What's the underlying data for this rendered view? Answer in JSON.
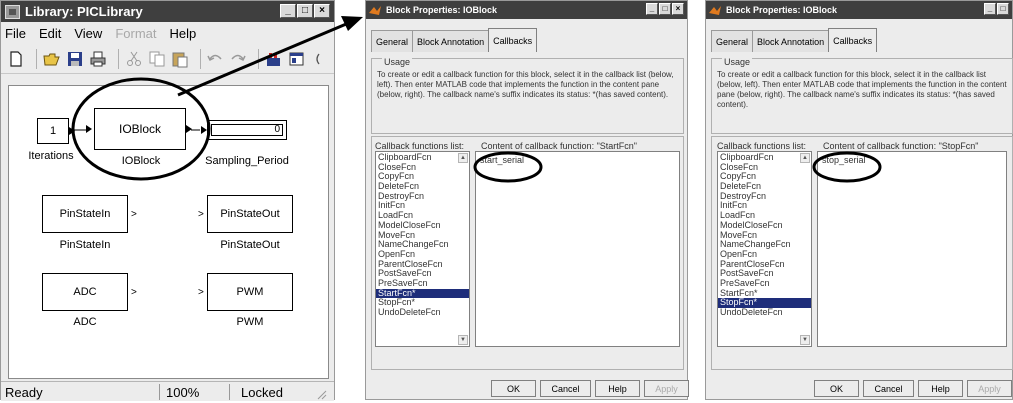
{
  "library": {
    "title": "Library: PICLibrary",
    "window_buttons": [
      "_",
      "□",
      "×"
    ],
    "menu": [
      "File",
      "Edit",
      "View",
      "Format",
      "Help"
    ],
    "toolbar_icons": [
      "new-icon",
      "open-icon",
      "save-icon",
      "print-icon",
      "cut-icon",
      "copy-icon",
      "paste-icon",
      "undo-icon",
      "redo-icon",
      "library-browser-icon",
      "model-explorer-icon"
    ],
    "blocks": {
      "iterations_value": "1",
      "iterations_label": "Iterations",
      "ioblock_text": "IOBlock",
      "ioblock_label": "IOBlock",
      "sampling_value": "0",
      "sampling_label": "Sampling_Period",
      "pinstatein_text": "PinStateIn",
      "pinstatein_label": "PinStateIn",
      "pinstateout_text": "PinStateOut",
      "pinstateout_label": "PinStateOut",
      "adc_text": "ADC",
      "adc_label": "ADC",
      "pwm_text": "PWM",
      "pwm_label": "PWM"
    },
    "status": {
      "state": "Ready",
      "zoom": "100%",
      "lock": "Locked"
    }
  },
  "dialogs": [
    {
      "title": "Block Properties: IOBlock",
      "tabs": [
        "General",
        "Block Annotation",
        "Callbacks"
      ],
      "usage_legend": "Usage",
      "usage_text": "To create or edit a callback function for this block, select it in the callback list (below, left). Then enter MATLAB code that implements the function in the content pane (below, right). The callback name's suffix indicates its status: *(has saved content).",
      "list_label": "Callback functions list:",
      "content_label": "Content of callback function: \"StartFcn\"",
      "callbacks": [
        "ClipboardFcn",
        "CloseFcn",
        "CopyFcn",
        "DeleteFcn",
        "DestroyFcn",
        "InitFcn",
        "LoadFcn",
        "ModelCloseFcn",
        "MoveFcn",
        "NameChangeFcn",
        "OpenFcn",
        "ParentCloseFcn",
        "PostSaveFcn",
        "PreSaveFcn",
        "StartFcn*",
        "StopFcn*",
        "UndoDeleteFcn"
      ],
      "selected_index": 14,
      "content": "start_serial",
      "buttons": [
        "OK",
        "Cancel",
        "Help",
        "Apply"
      ]
    },
    {
      "title": "Block Properties: IOBlock",
      "tabs": [
        "General",
        "Block Annotation",
        "Callbacks"
      ],
      "usage_legend": "Usage",
      "usage_text": "To create or edit a callback function for this block, select it in the callback list (below, left). Then enter MATLAB code that implements the function in the content pane (below, right). The callback name's suffix indicates its status: *(has saved content).",
      "list_label": "Callback functions list:",
      "content_label": "Content of callback function: \"StopFcn\"",
      "callbacks": [
        "ClipboardFcn",
        "CloseFcn",
        "CopyFcn",
        "DeleteFcn",
        "DestroyFcn",
        "InitFcn",
        "LoadFcn",
        "ModelCloseFcn",
        "MoveFcn",
        "NameChangeFcn",
        "OpenFcn",
        "ParentCloseFcn",
        "PostSaveFcn",
        "PreSaveFcn",
        "StartFcn*",
        "StopFcn*",
        "UndoDeleteFcn"
      ],
      "selected_index": 15,
      "content": "stop_serial",
      "buttons": [
        "OK",
        "Cancel",
        "Help",
        "Apply"
      ]
    }
  ],
  "colors": {
    "titlebar": "#3f3f3f",
    "selection": "#1e2d7a",
    "annotation": "#000000"
  }
}
